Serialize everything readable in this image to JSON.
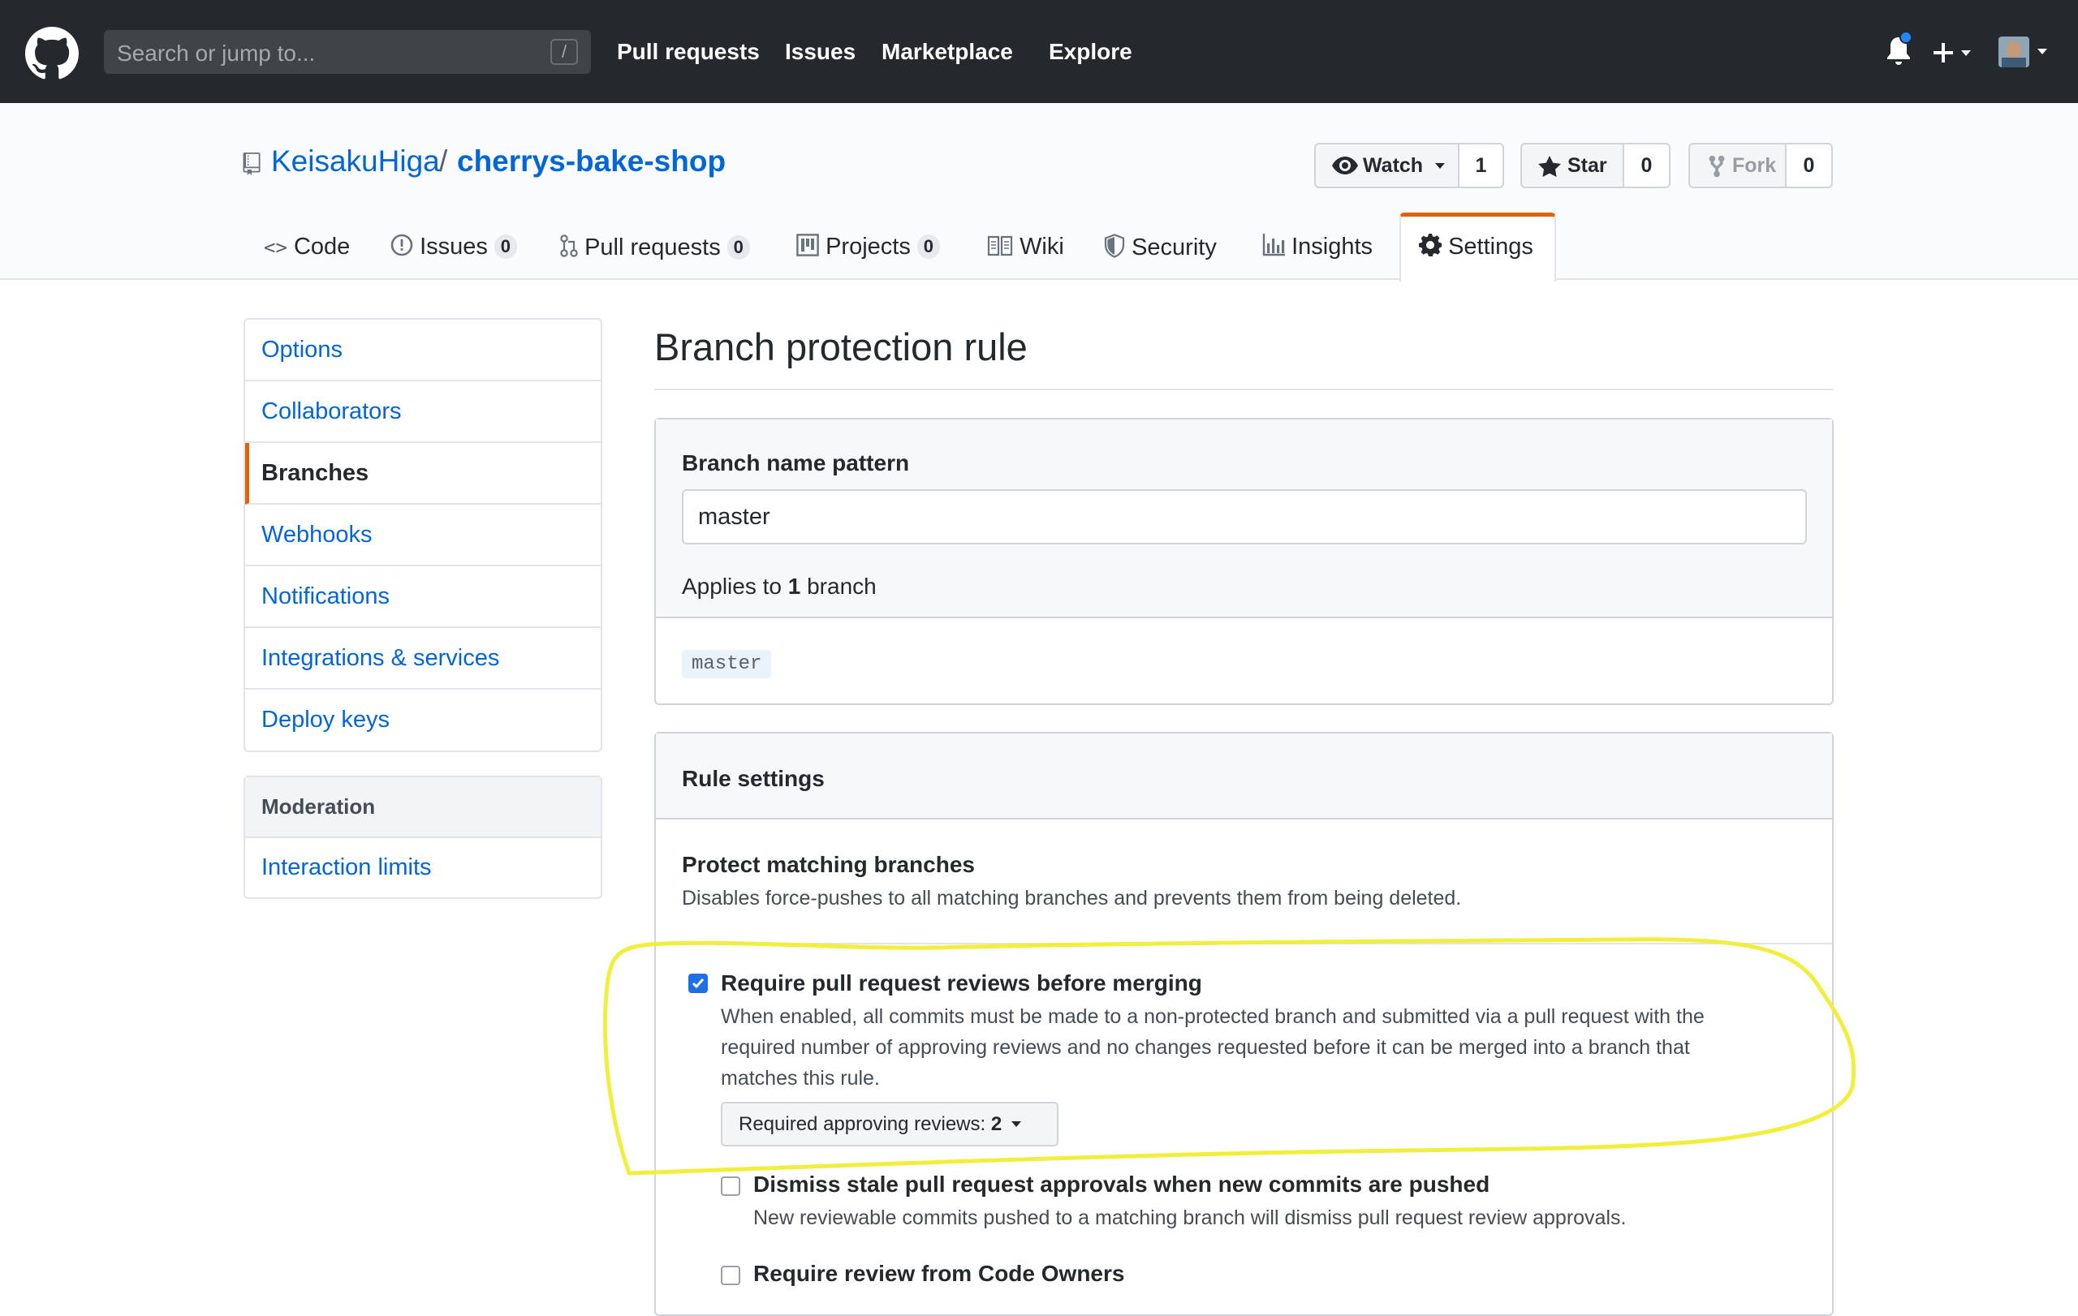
{
  "header": {
    "search_placeholder": "Search or jump to...",
    "search_shortcut": "/",
    "nav": [
      "Pull requests",
      "Issues",
      "Marketplace",
      "Explore"
    ]
  },
  "repo": {
    "owner": "KeisakuHiga",
    "separator": "/",
    "name": "cherrys-bake-shop",
    "watch_label": "Watch",
    "watch_count": "1",
    "star_label": "Star",
    "star_count": "0",
    "fork_label": "Fork",
    "fork_count": "0"
  },
  "tabs": [
    {
      "label": "Code",
      "icon": "code-icon"
    },
    {
      "label": "Issues",
      "count": "0",
      "icon": "issue-icon"
    },
    {
      "label": "Pull requests",
      "count": "0",
      "icon": "pull-request-icon"
    },
    {
      "label": "Projects",
      "count": "0",
      "icon": "project-icon"
    },
    {
      "label": "Wiki",
      "icon": "book-icon"
    },
    {
      "label": "Security",
      "icon": "shield-icon"
    },
    {
      "label": "Insights",
      "icon": "graph-icon"
    },
    {
      "label": "Settings",
      "icon": "gear-icon",
      "selected": true
    }
  ],
  "sidebar": {
    "items": [
      "Options",
      "Collaborators",
      "Branches",
      "Webhooks",
      "Notifications",
      "Integrations & services",
      "Deploy keys"
    ],
    "selected": "Branches",
    "moderation_heading": "Moderation",
    "moderation_items": [
      "Interaction limits"
    ]
  },
  "main": {
    "title": "Branch protection rule",
    "branch_name_pattern_label": "Branch name pattern",
    "branch_name_pattern_value": "master",
    "applies_prefix": "Applies to",
    "applies_count": "1",
    "applies_suffix": "branch",
    "matched_branch": "master",
    "rule_settings_heading": "Rule settings",
    "protect_title": "Protect matching branches",
    "protect_desc": "Disables force-pushes to all matching branches and prevents them from being deleted.",
    "options": [
      {
        "title": "Require pull request reviews before merging",
        "checked": true,
        "desc_lines": [
          "When enabled, all commits must be made to a non-protected branch and submitted via a pull request with the",
          "required number of approving reviews and no changes requested before it can be merged into a branch that",
          "matches this rule."
        ]
      },
      {
        "title": "Dismiss stale pull request approvals when new commits are pushed",
        "checked": false,
        "desc_lines": [
          "New reviewable commits pushed to a matching branch will dismiss pull request review approvals."
        ]
      },
      {
        "title": "Require review from Code Owners",
        "checked": false
      }
    ],
    "required_reviews_label": "Required approving reviews:",
    "required_reviews_value": "2"
  },
  "annotation": {
    "color": "#f2ee3d"
  },
  "colors": {
    "header_bg": "#24292e",
    "link": "#0366d6",
    "accent": "#e36209",
    "checkbox": "#1f6fe5"
  }
}
